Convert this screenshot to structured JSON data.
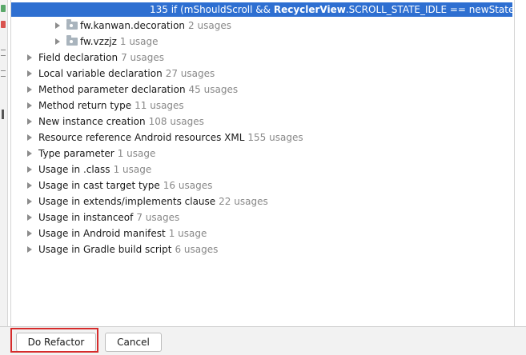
{
  "code_line": {
    "prefix": "135 if (mShouldScroll && ",
    "bold": "RecyclerView",
    "suffix": ".SCROLL_STATE_IDLE == newState) {"
  },
  "packages": [
    {
      "label": "fw.kanwan.decoration",
      "usages": "2 usages"
    },
    {
      "label": "fw.vzzjz",
      "usages": "1 usage"
    }
  ],
  "groups": [
    {
      "label": "Field declaration",
      "usages": "7 usages"
    },
    {
      "label": "Local variable declaration",
      "usages": "27 usages"
    },
    {
      "label": "Method parameter declaration",
      "usages": "45 usages"
    },
    {
      "label": "Method return type",
      "usages": "11 usages"
    },
    {
      "label": "New instance creation",
      "usages": "108 usages"
    },
    {
      "label": "Resource reference Android resources XML",
      "usages": "155 usages"
    },
    {
      "label": "Type parameter",
      "usages": "1 usage"
    },
    {
      "label": "Usage in .class",
      "usages": "1 usage"
    },
    {
      "label": "Usage in cast target type",
      "usages": "16 usages"
    },
    {
      "label": "Usage in extends/implements clause",
      "usages": "22 usages"
    },
    {
      "label": "Usage in instanceof",
      "usages": "7 usages"
    },
    {
      "label": "Usage in Android manifest",
      "usages": "1 usage"
    },
    {
      "label": "Usage in Gradle build script",
      "usages": "6 usages"
    }
  ],
  "buttons": {
    "do_refactor": "Do Refactor",
    "cancel": "Cancel"
  },
  "colors": {
    "selection": "#2e6fd1",
    "highlight_border": "#d62b2b",
    "usage_count": "#888888"
  }
}
